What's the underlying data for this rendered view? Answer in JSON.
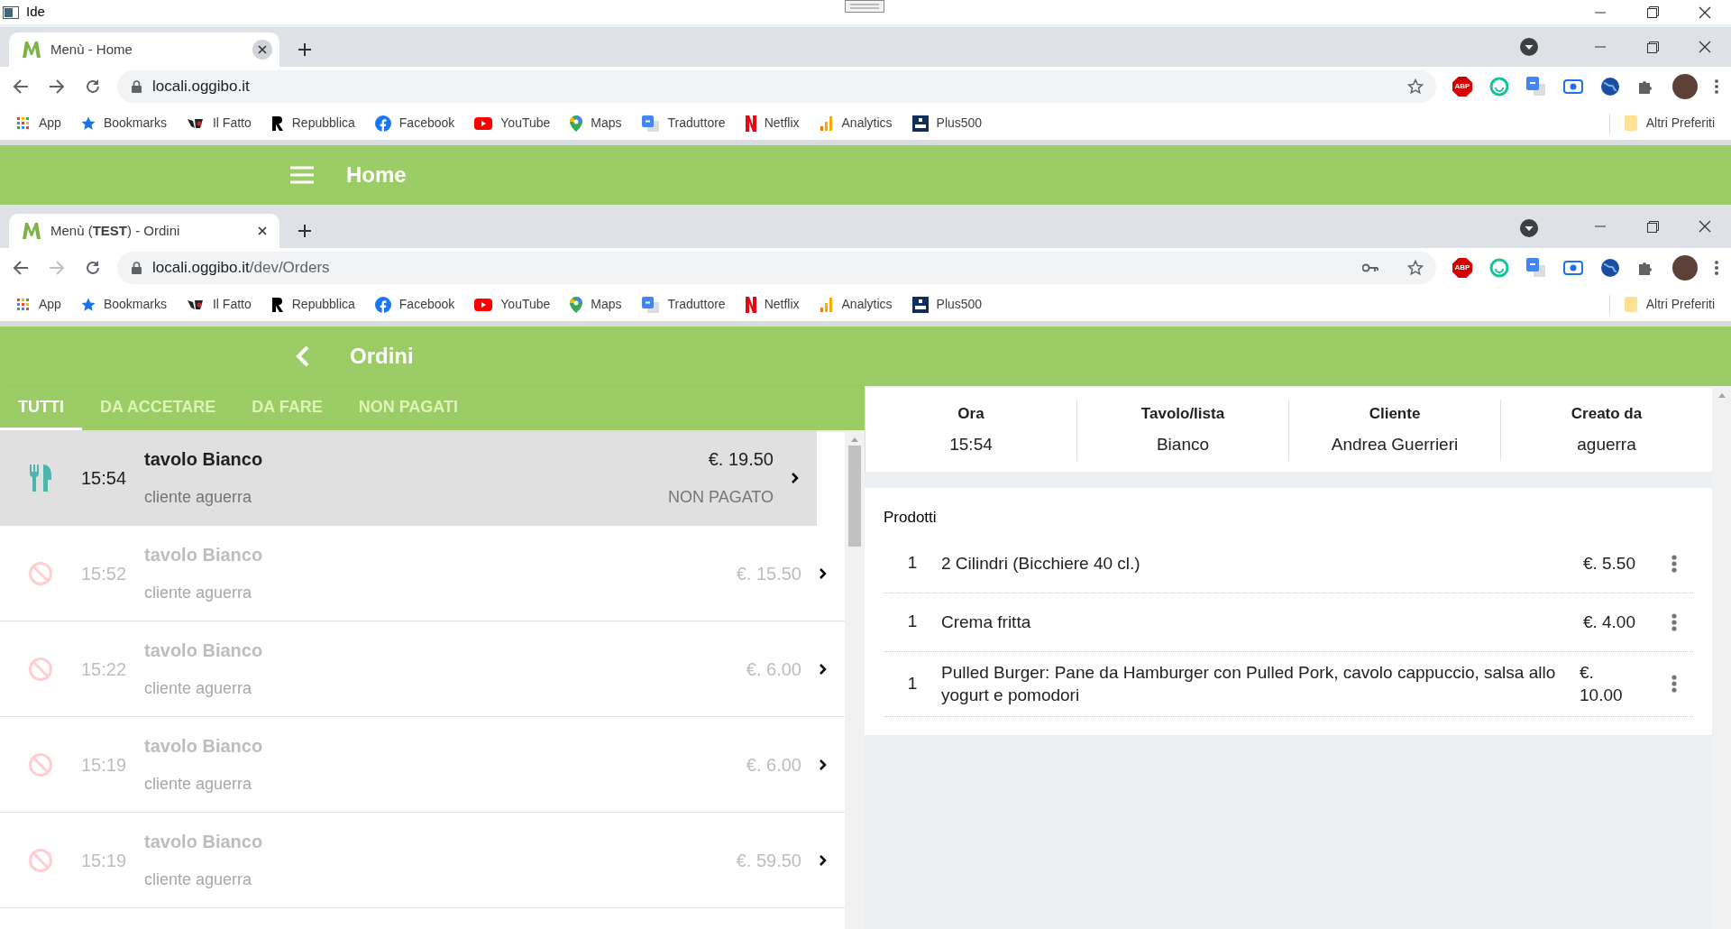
{
  "window": {
    "title": "Ide"
  },
  "browsers": [
    {
      "tab": {
        "title": "Menù - Home",
        "close_hovered": true
      },
      "url": {
        "host": "locali.oggibo.it"
      },
      "forward_enabled": true,
      "key_icon": false,
      "extension_label": "ABP",
      "bookmarks": [
        "App",
        "Bookmarks",
        "Il Fatto",
        "Repubblica",
        "Facebook",
        "YouTube",
        "Maps",
        "Traduttore",
        "Netflix",
        "Analytics",
        "Plus500"
      ],
      "other_bookmarks": "Altri Preferiti",
      "app_bar": {
        "kind": "menu",
        "title": "Home"
      }
    },
    {
      "tab": {
        "title": "Menù (**TEST**) - Ordini",
        "close_hovered": false
      },
      "url": {
        "host": "locali.oggibo.it",
        "path": "/dev/Orders"
      },
      "forward_enabled": false,
      "key_icon": true,
      "extension_label": "ABP",
      "bookmarks": [
        "App",
        "Bookmarks",
        "Il Fatto",
        "Repubblica",
        "Facebook",
        "YouTube",
        "Maps",
        "Traduttore",
        "Netflix",
        "Analytics",
        "Plus500"
      ],
      "other_bookmarks": "Altri Preferiti",
      "app_bar": {
        "kind": "back",
        "title": "Ordini"
      }
    }
  ],
  "order_tabs": [
    {
      "label": "TUTTI",
      "selected": true
    },
    {
      "label": "DA ACCETARE",
      "selected": false
    },
    {
      "label": "DA FARE",
      "selected": false
    },
    {
      "label": "NON PAGATI",
      "selected": false
    }
  ],
  "orders": [
    {
      "kind": "active",
      "selected": true,
      "time": "15:54",
      "table": "tavolo Bianco",
      "customer": "cliente aguerra",
      "total": "€. 19.50",
      "payment": "NON PAGATO"
    },
    {
      "kind": "cancelled",
      "selected": false,
      "time": "15:52",
      "table": "tavolo Bianco",
      "customer": "cliente aguerra",
      "total": "€. 15.50"
    },
    {
      "kind": "cancelled",
      "selected": false,
      "time": "15:22",
      "table": "tavolo Bianco",
      "customer": "cliente aguerra",
      "total": "€. 6.00"
    },
    {
      "kind": "cancelled",
      "selected": false,
      "time": "15:19",
      "table": "tavolo Bianco",
      "customer": "cliente aguerra",
      "total": "€. 6.00"
    },
    {
      "kind": "cancelled",
      "selected": false,
      "time": "15:19",
      "table": "tavolo Bianco",
      "customer": "cliente aguerra",
      "total": "€. 59.50"
    }
  ],
  "detail": {
    "fields": [
      {
        "label": "Ora",
        "value": "15:54"
      },
      {
        "label": "Tavolo/lista",
        "value": "Bianco"
      },
      {
        "label": "Cliente",
        "value": "Andrea Guerrieri"
      },
      {
        "label": "Creato da",
        "value": "aguerra"
      }
    ],
    "products_title": "Prodotti",
    "products": [
      {
        "qty": "1",
        "name": "2 Cilindri (Bicchiere 40 cl.)",
        "price": "€. 5.50"
      },
      {
        "qty": "1",
        "name": "Crema fritta",
        "price": "€. 4.00"
      },
      {
        "qty": "1",
        "name": "Pulled Burger: Pane da Hamburger con Pulled Pork, cavolo cappuccio, salsa allo yogurt e pomodori",
        "price": "€. 10.00"
      }
    ]
  }
}
